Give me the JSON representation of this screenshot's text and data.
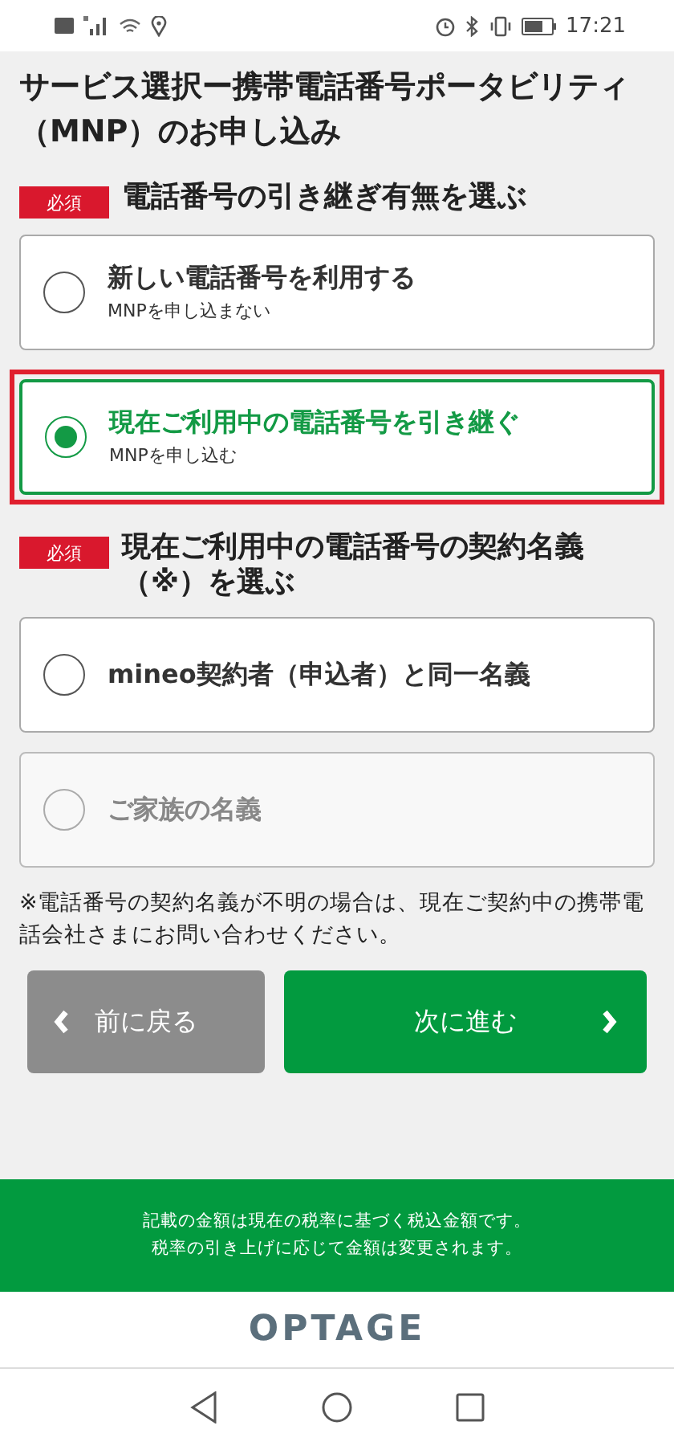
{
  "status_bar": {
    "time": "17:21"
  },
  "title": "サービス選択ー携帯電話番号ポータビリティ（MNP）のお申し込み",
  "sections": [
    {
      "badge": "必須",
      "heading": "電話番号の引き継ぎ有無を選ぶ",
      "options": [
        {
          "label": "新しい電話番号を利用する",
          "sub": "MNPを申し込まない",
          "selected": false,
          "disabled": false,
          "highlighted": false
        },
        {
          "label": "現在ご利用中の電話番号を引き継ぐ",
          "sub": "MNPを申し込む",
          "selected": true,
          "disabled": false,
          "highlighted": true
        }
      ]
    },
    {
      "badge": "必須",
      "heading": "現在ご利用中の電話番号の契約名義（※）を選ぶ",
      "options": [
        {
          "label": "mineo契約者（申込者）と同一名義",
          "selected": false,
          "disabled": false,
          "highlighted": false
        },
        {
          "label": "ご家族の名義",
          "selected": false,
          "disabled": true,
          "highlighted": false
        }
      ]
    }
  ],
  "note": "※電話番号の契約名義が不明の場合は、現在ご契約中の携帯電話会社さまにお問い合わせください。",
  "buttons": [
    {
      "kind": "back",
      "label": "前に戻る"
    },
    {
      "kind": "next",
      "label": "次に進む"
    }
  ],
  "footer_notice": [
    "記載の金額は現在の税率に基づく税込金額です。",
    "税率の引き上げに応じて金額は変更されます。"
  ],
  "logo": "OPTAGE"
}
